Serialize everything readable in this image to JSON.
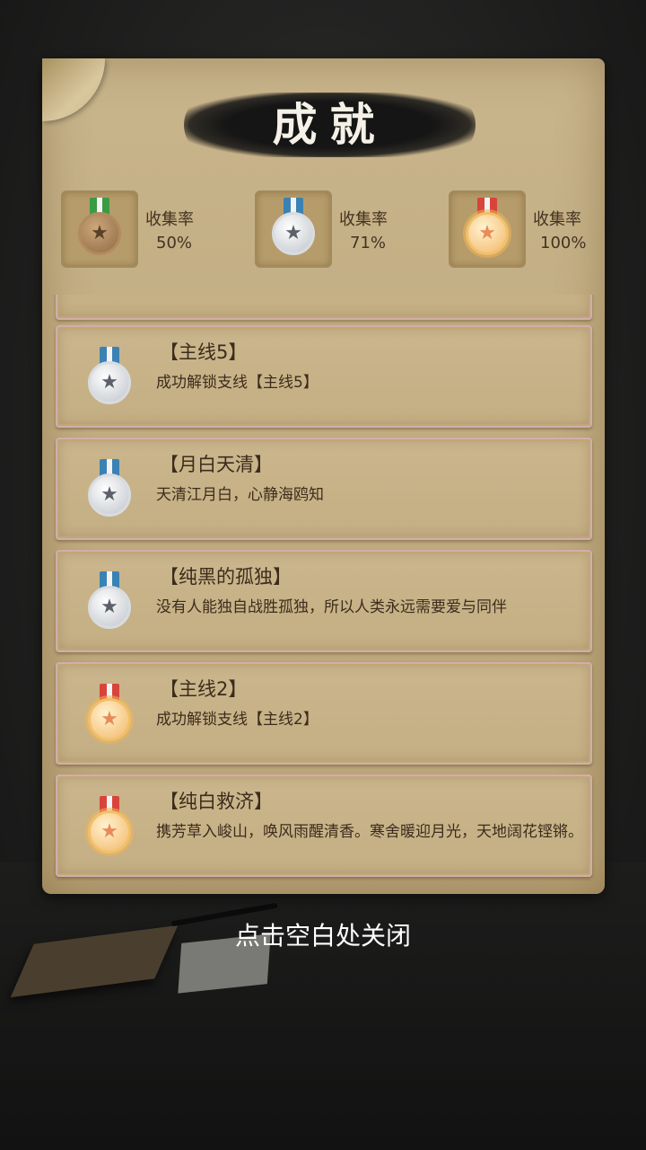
{
  "header": {
    "title": "成就"
  },
  "stats": [
    {
      "label": "收集率",
      "value": "50%",
      "medal": "bronze-medal-icon"
    },
    {
      "label": "收集率",
      "value": "71%",
      "medal": "silver-medal-icon"
    },
    {
      "label": "收集率",
      "value": "100%",
      "medal": "gold-medal-icon"
    }
  ],
  "achievements": [
    {
      "title": "【主线5】",
      "desc": "成功解锁支线【主线5】",
      "medal": "silver"
    },
    {
      "title": "【月白天清】",
      "desc": "天清江月白，心静海鸥知",
      "medal": "silver"
    },
    {
      "title": "【纯黑的孤独】",
      "desc": "没有人能独自战胜孤独，所以人类永远需要爱与同伴",
      "medal": "silver"
    },
    {
      "title": "【主线2】",
      "desc": "成功解锁支线【主线2】",
      "medal": "gold"
    },
    {
      "title": "【纯白救济】",
      "desc": "携芳草入峻山，唤风雨醒清香。寒舍暖迎月光，天地阔花铿锵。",
      "medal": "gold"
    }
  ],
  "footer": {
    "close_hint": "点击空白处关闭"
  },
  "colors": {
    "parchment": "#c4ae83",
    "card_border": "#d2aeaa",
    "ink": "#151515"
  }
}
